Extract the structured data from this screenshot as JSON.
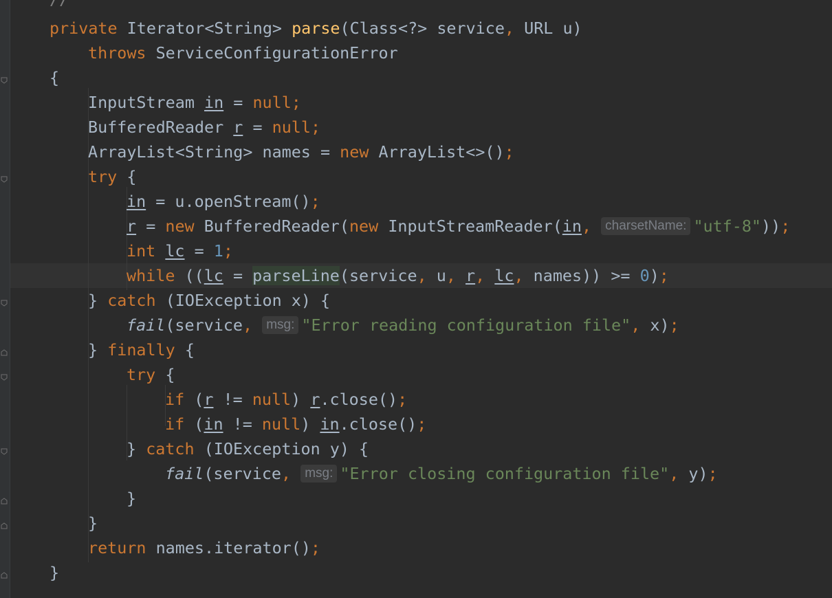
{
  "editor": {
    "background": "#2b2b2b",
    "colors": {
      "keyword": "#cc7832",
      "method_decl": "#ffc66d",
      "string": "#6a8759",
      "number": "#6897bb",
      "comment": "#808080",
      "default": "#a9b7c6"
    },
    "lines": {
      "l0": {
        "comment": "//"
      },
      "l1": {
        "kw_private": "private",
        "t1": "Iterator<String>",
        "method": "parse",
        "t2": "(Class<?> service",
        "comma": ",",
        "t3": "URL u)"
      },
      "l2": {
        "kw_throws": "throws",
        "t1": "ServiceConfigurationError"
      },
      "l3": {
        "brace": "{"
      },
      "l4": {
        "t1": "InputStream",
        "var": "in",
        "t2": "=",
        "kw_null": "null",
        "semi": ";"
      },
      "l5": {
        "t1": "BufferedReader",
        "var": "r",
        "t2": "=",
        "kw_null": "null",
        "semi": ";"
      },
      "l6": {
        "t1": "ArrayList<String> names =",
        "kw_new": "new",
        "t2": "ArrayList<>()",
        "semi": ";"
      },
      "l7": {
        "kw_try": "try",
        "t1": "{"
      },
      "l8": {
        "var": "in",
        "t1": "= u.openStream()",
        "semi": ";"
      },
      "l9": {
        "var": "r",
        "t1": "=",
        "kw_new1": "new",
        "t2": "BufferedReader(",
        "kw_new2": "new",
        "t3": "InputStreamReader(",
        "var2": "in",
        "comma": ",",
        "hint": "charsetName:",
        "str": "\"utf-8\"",
        "t4": "))",
        "semi": ";"
      },
      "l10": {
        "kw_int": "int",
        "var": "lc",
        "t1": "=",
        "num": "1",
        "semi": ";"
      },
      "l11": {
        "kw_while": "while",
        "t1": "((",
        "var": "lc",
        "t2": "=",
        "call": "parseLine",
        "t3": "(service",
        "c1": ",",
        "t4": "u",
        "c2": ",",
        "var2": "r",
        "c3": ",",
        "var3": "lc",
        "c4": ",",
        "t5": "names)) >=",
        "num": "0",
        "t6": ")",
        "semi": ";"
      },
      "l12": {
        "t1": "}",
        "kw_catch": "catch",
        "t2": "(IOException x) {"
      },
      "l13": {
        "call": "fail",
        "t1": "(service",
        "comma": ",",
        "hint": "msg:",
        "str": "\"Error reading configuration file\"",
        "comma2": ",",
        "t2": "x)",
        "semi": ";"
      },
      "l14": {
        "t1": "}",
        "kw_finally": "finally",
        "t2": "{"
      },
      "l15": {
        "kw_try": "try",
        "t1": "{"
      },
      "l16": {
        "kw_if": "if",
        "t1": "(",
        "var": "r",
        "t2": "!=",
        "kw_null": "null",
        "t3": ")",
        "var2": "r",
        "t4": ".close()",
        "semi": ";"
      },
      "l17": {
        "kw_if": "if",
        "t1": "(",
        "var": "in",
        "t2": "!=",
        "kw_null": "null",
        "t3": ")",
        "var2": "in",
        "t4": ".close()",
        "semi": ";"
      },
      "l18": {
        "t1": "}",
        "kw_catch": "catch",
        "t2": "(IOException y) {"
      },
      "l19": {
        "call": "fail",
        "t1": "(service",
        "comma": ",",
        "hint": "msg:",
        "str": "\"Error closing configuration file\"",
        "comma2": ",",
        "t2": "y)",
        "semi": ";"
      },
      "l20": {
        "t1": "}"
      },
      "l21": {
        "t1": "}"
      },
      "l22": {
        "kw_return": "return",
        "t1": "names.iterator()",
        "semi": ";"
      },
      "l23": {
        "t1": "}"
      }
    }
  }
}
